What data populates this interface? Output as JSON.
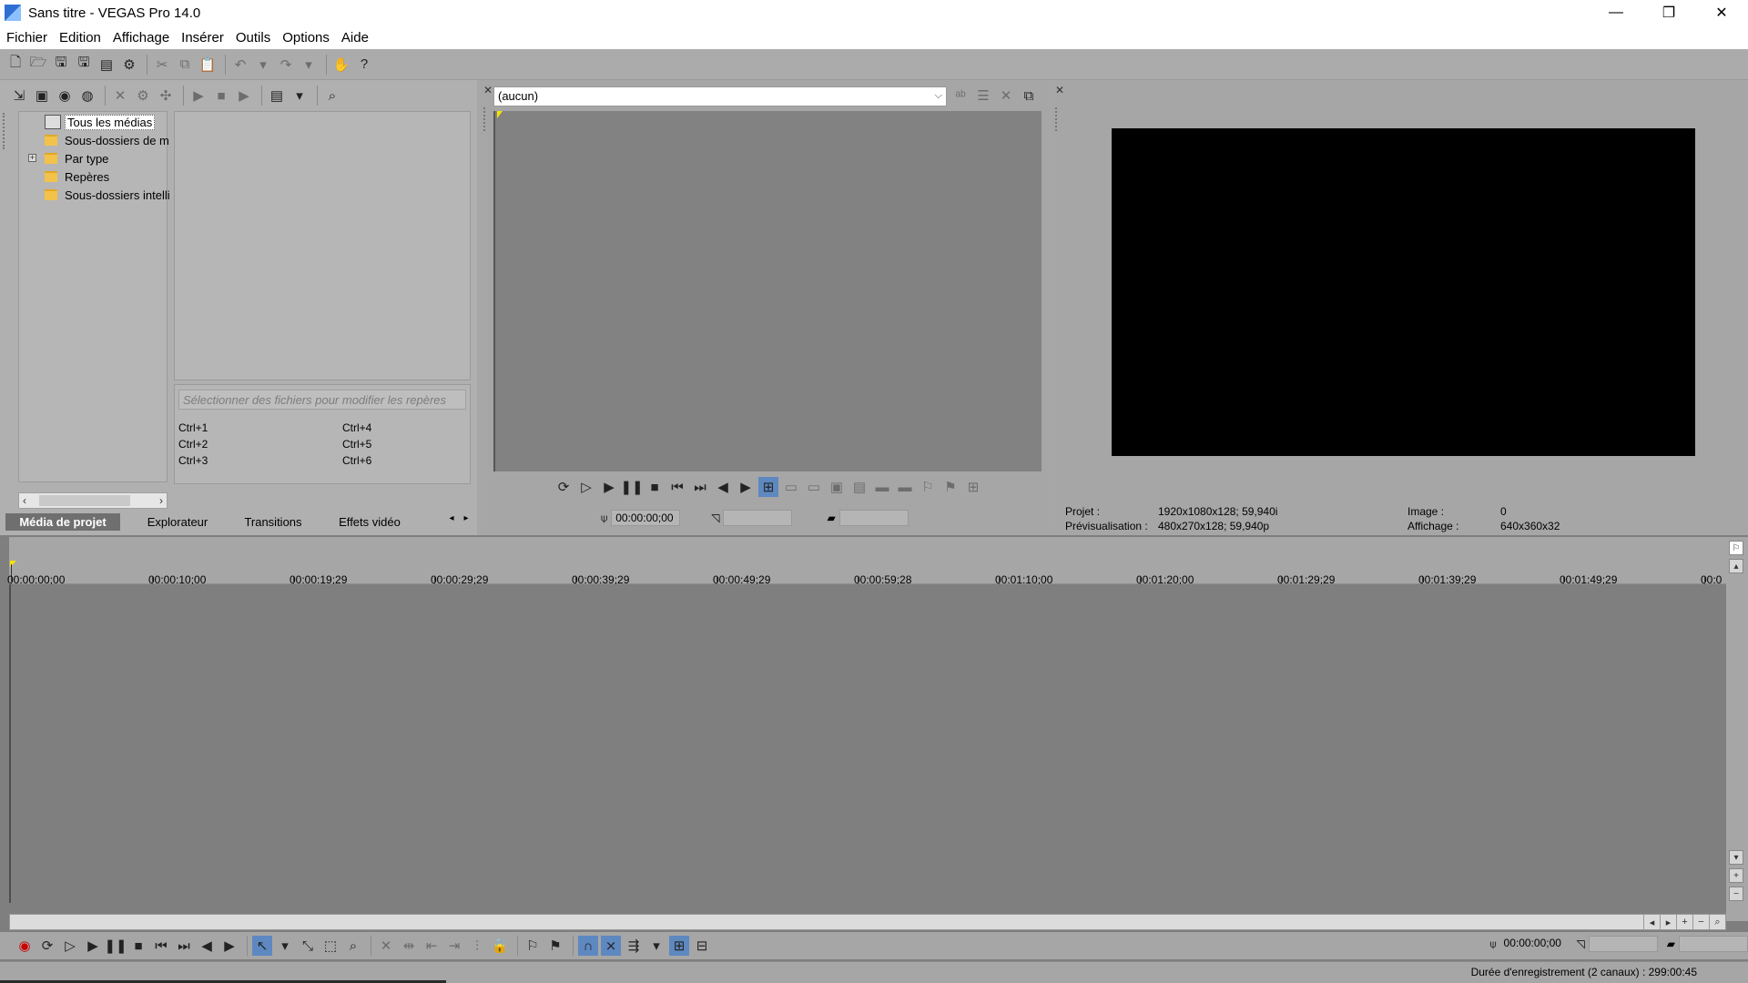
{
  "window": {
    "title": "Sans titre - VEGAS Pro 14.0",
    "minimize": "—",
    "restore": "❐",
    "close": "✕"
  },
  "menu": [
    "Fichier",
    "Edition",
    "Affichage",
    "Insérer",
    "Outils",
    "Options",
    "Aide"
  ],
  "media_panel": {
    "tree": [
      {
        "label": "Tous les médias",
        "icon": "library-icon",
        "selected": true,
        "expandable": false
      },
      {
        "label": "Sous-dossiers de m",
        "icon": "folder-icon",
        "selected": false,
        "expandable": false
      },
      {
        "label": "Par type",
        "icon": "folder-icon",
        "selected": false,
        "expandable": true
      },
      {
        "label": "Repères",
        "icon": "folder-icon",
        "selected": false,
        "expandable": false
      },
      {
        "label": "Sous-dossiers intelli",
        "icon": "folder-icon",
        "selected": false,
        "expandable": false
      }
    ],
    "marker_hint": "Sélectionner des fichiers pour modifier les repères",
    "shortcuts_left": [
      "Ctrl+1",
      "Ctrl+2",
      "Ctrl+3"
    ],
    "shortcuts_right": [
      "Ctrl+4",
      "Ctrl+5",
      "Ctrl+6"
    ],
    "tabs": [
      {
        "label": "Média de projet",
        "active": true
      },
      {
        "label": "Explorateur",
        "active": false
      },
      {
        "label": "Transitions",
        "active": false
      },
      {
        "label": "Effets vidéo",
        "active": false
      }
    ]
  },
  "trimmer": {
    "source": "(aucun)",
    "timecode": "00:00:00;00"
  },
  "preview": {
    "project_label": "Projet :",
    "project_value": "1920x1080x128; 59,940i",
    "preview_label": "Prévisualisation :",
    "preview_value": "480x270x128; 59,940p",
    "image_label": "Image :",
    "image_value": "0",
    "display_label": "Affichage :",
    "display_value": "640x360x32"
  },
  "timeline": {
    "ticks": [
      "00:00:00;00",
      "00:00:10;00",
      "00:00:19;29",
      "00:00:29;29",
      "00:00:39;29",
      "00:00:49;29",
      "00:00:59;28",
      "00:01:10;00",
      "00:01:20;00",
      "00:01:29;29",
      "00:01:39;29",
      "00:01:49;29",
      "00:0"
    ],
    "cursor_timecode": "00:00:00;00"
  },
  "status": {
    "text": "Durée d'enregistrement (2 canaux) : 299:00:45"
  }
}
